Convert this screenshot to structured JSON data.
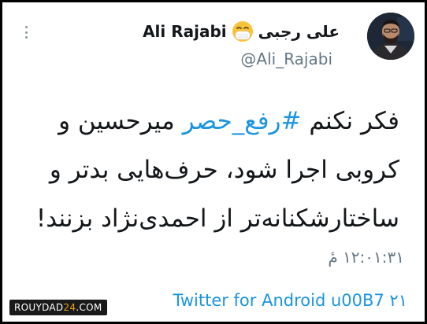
{
  "tweet_card": {
    "author_name": "علی رجبی",
    "author_name_latin": "Ali Rajabi",
    "author_emoji_icon": "face-with-medical-mask-icon",
    "handle": "@Ali_Rajabi",
    "text_lines": [
      {
        "before": "فکر نکنم ",
        "hashtag": "#رفع_حصر",
        "after": " میرحسین و"
      },
      {
        "text": "کروبی اجرا شود، حرف‌هایی بدتر و"
      },
      {
        "text": "ساختارشکنانه‌تر از احمدی‌نژاد بزنند!"
      }
    ],
    "timestamp": "۱۲:۰۱:۳۱ مٔ",
    "source": "Twitter for Android u00B7 ۲۱"
  },
  "watermark": {
    "text_main": "ROUYDAD",
    "text_accent": "24",
    "text_tail": ".COM"
  },
  "colors": {
    "link": "#1b95e0",
    "secondary_text": "#657786",
    "primary_text": "#14171a",
    "frame": "#000000"
  }
}
